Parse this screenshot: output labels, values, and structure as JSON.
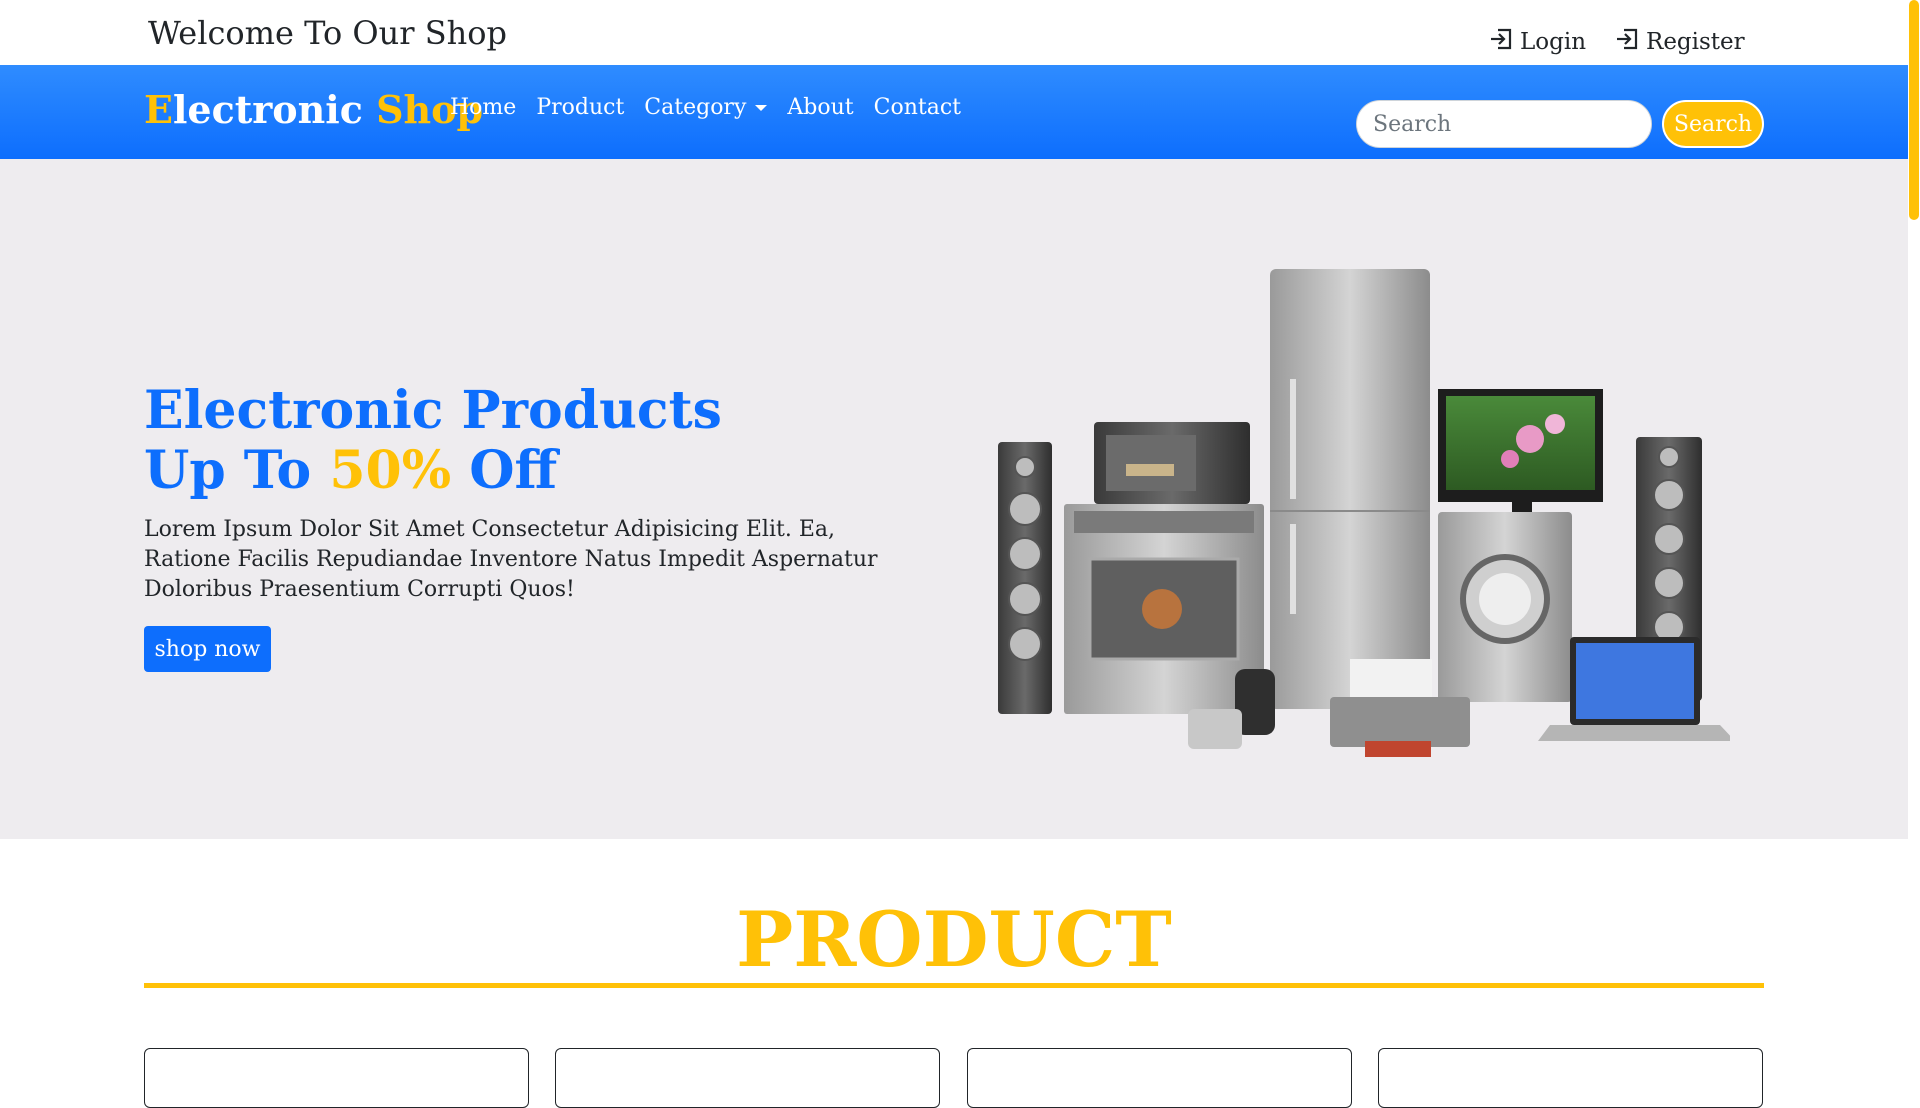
{
  "topbar": {
    "welcome": "Welcome To Our Shop",
    "login": "Login",
    "register": "Register"
  },
  "navbar": {
    "brand_first": "E",
    "brand_rest": "lectronic ",
    "brand_shop": "Shop",
    "links": [
      "Home",
      "Product",
      "Category",
      "About",
      "Contact"
    ],
    "search_placeholder": "Search",
    "search_button": "Search"
  },
  "hero": {
    "title_line1": "Electronic Products",
    "title_line2_a": "Up To ",
    "title_line2_pct": "50%",
    "title_line2_b": " Off",
    "description": "Lorem Ipsum Dolor Sit Amet Consectetur Adipisicing Elit. Ea, Ratione Facilis Repudiandae Inventore Natus Impedit Aspernatur Doloribus Praesentium Corrupti Quos!",
    "button": "shop now"
  },
  "product_section": {
    "title": "PRODUCT"
  },
  "colors": {
    "primary": "#0d6efd",
    "accent": "#ffc107",
    "hero_bg": "#eeecef"
  },
  "icons": {
    "login": "login-icon",
    "register": "register-icon",
    "category_caret": "chevron-down-icon"
  }
}
